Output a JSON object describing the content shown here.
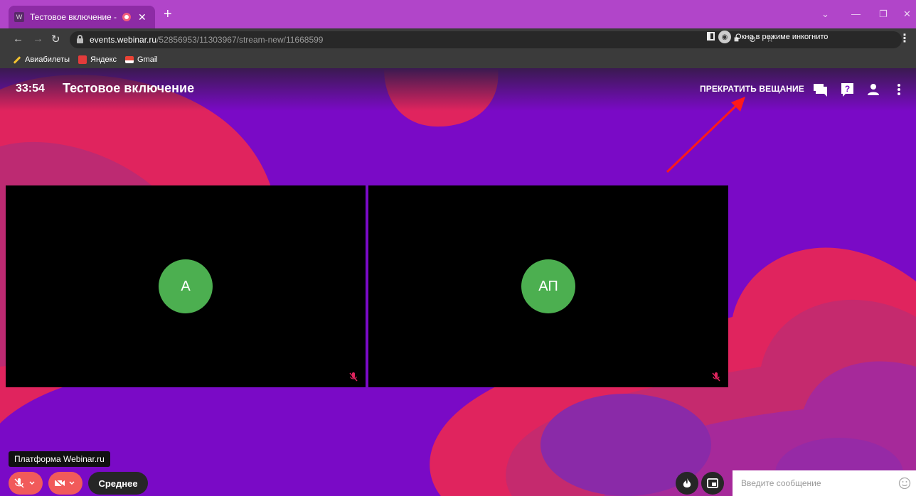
{
  "browser": {
    "tab_title": "Тестовое включение - платформа Webinar.ru",
    "favicon_letter": "W",
    "new_tab": "+",
    "url_host": "events.webinar.ru",
    "url_path": "/52856953/11303967/stream-new/11668599",
    "incognito_label": "Окно в режиме инкогнито",
    "bookmarks": [
      {
        "label": "Авиабилеты",
        "color": "#f2c230"
      },
      {
        "label": "Яндекс",
        "color": "#e33b3b"
      },
      {
        "label": "Gmail",
        "color": "#ea4335"
      }
    ]
  },
  "webinar": {
    "timer": "33:54",
    "title": "Тестовое включение",
    "stop_label": "ПРЕКРАТИТЬ ВЕЩАНИЕ",
    "participants": [
      {
        "initials": "А"
      },
      {
        "initials": "АП"
      }
    ],
    "tooltip": "Платформа Webinar.ru",
    "quality_label": "Среднее",
    "chat_placeholder": "Введите сообщение",
    "colors": {
      "background": "#7a0ac6",
      "blob": "#e0245e",
      "avatar": "#4caf50",
      "control_red": "#f15a5a",
      "annotation_arrow": "#ff1a1a"
    }
  }
}
